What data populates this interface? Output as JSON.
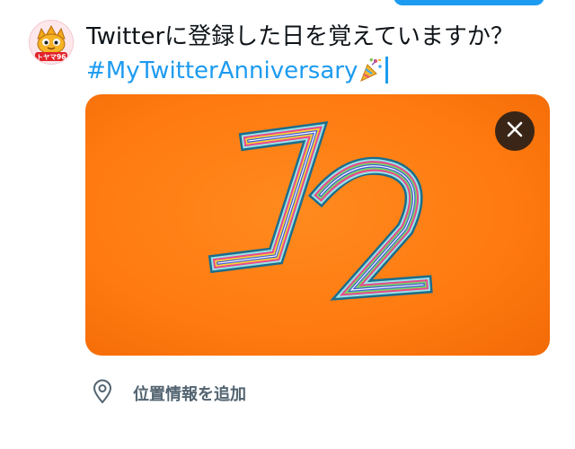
{
  "compose": {
    "text_line1": "Twitterに登録した日を覚えていますか？",
    "hashtag": "#MyTwitterAnniversary"
  },
  "avatar": {
    "badge_text": "トヤマ96"
  },
  "media": {
    "image_number": "12"
  },
  "location": {
    "label": "位置情報を追加"
  },
  "colors": {
    "accent": "#1d9bf0",
    "media_background": "#ff7a10",
    "muted_text": "#536471"
  }
}
